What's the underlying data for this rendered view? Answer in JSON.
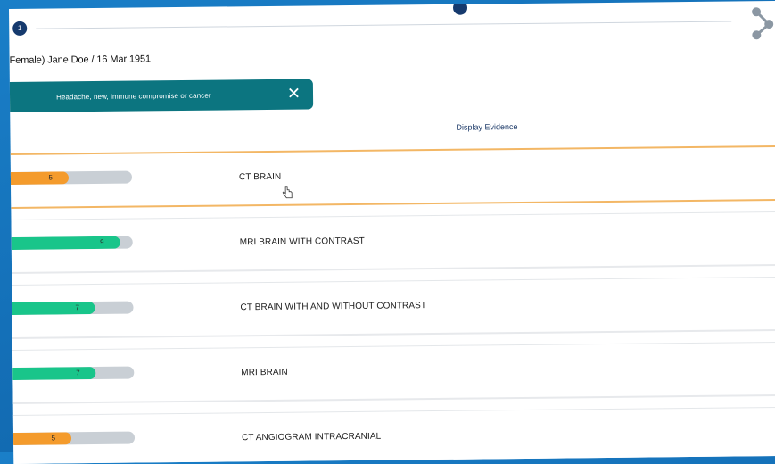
{
  "stepper": {
    "first_step": "1"
  },
  "patient": {
    "label": "Female) Jane Doe / 16 Mar 1951"
  },
  "filter_chip": {
    "label": "Headache, new, immune compromise or cancer",
    "close_symbol": "✕"
  },
  "evidence": {
    "label": "Display Evidence"
  },
  "colors": {
    "orange": "#f49b2c",
    "green": "#19c58a",
    "track": "#c9cfd5",
    "teal": "#0c7580"
  },
  "procedures": [
    {
      "label": "CT BRAIN",
      "score": "5",
      "level": 0.5,
      "color": "orange",
      "active": true
    },
    {
      "label": "MRI BRAIN WITH CONTRAST",
      "score": "9",
      "level": 0.9,
      "color": "green"
    },
    {
      "label": "CT BRAIN WITH AND WITHOUT CONTRAST",
      "score": "7",
      "level": 0.7,
      "color": "green"
    },
    {
      "label": "MRI BRAIN",
      "score": "7",
      "level": 0.7,
      "color": "green"
    },
    {
      "label": "CT ANGIOGRAM INTRACRANIAL",
      "score": "5",
      "level": 0.5,
      "color": "orange"
    }
  ]
}
